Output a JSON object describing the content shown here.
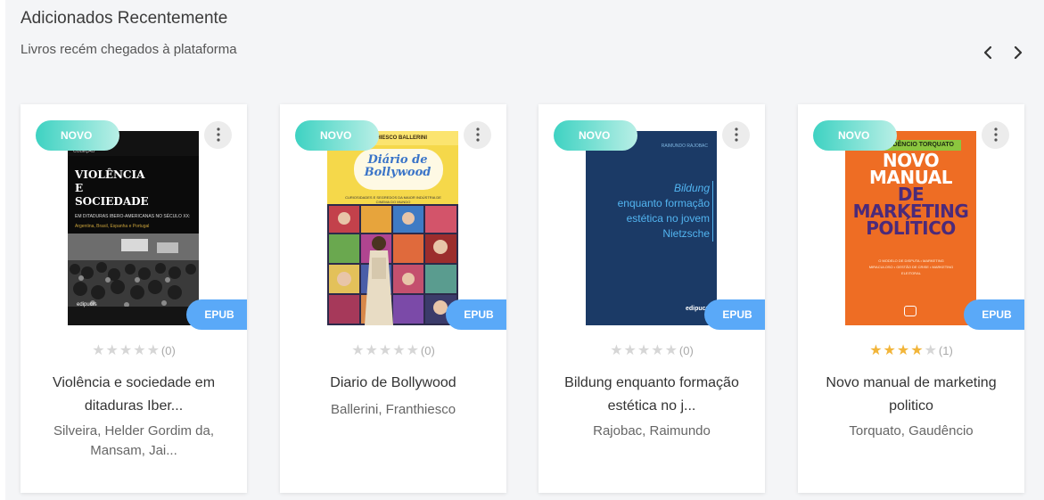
{
  "section": {
    "title": "Adicionados Recentemente",
    "subtitle": "Livros recém chegados à plataforma"
  },
  "nav": {
    "prev_icon": "chevron-left-icon",
    "next_icon": "chevron-right-icon"
  },
  "colors": {
    "novo_badge": "#3ed2c2",
    "epub_badge": "#5aa9f8",
    "star_on": "#f2b53a",
    "star_off": "#d6d6d6"
  },
  "books": [
    {
      "badge": "NOVO",
      "format": "EPUB",
      "rating": 0,
      "rating_count": "(0)",
      "title": "Violência e sociedade em ditaduras Iber...",
      "author": "Silveira, Helder Gordim da, Mansam, Jai...",
      "cover": {
        "series": "COLEÇÃO",
        "title_l1": "VIOLÊNCIA",
        "title_l2": "E",
        "title_l3": "SOCIEDADE",
        "subtitle": "EM DITADURAS IBERO-AMERICANAS NO SÉCULO XX:",
        "subtitle2": "Argentina, Brasil, Espanha e Portugal",
        "publisher": "edipucrs"
      }
    },
    {
      "badge": "NOVO",
      "format": "EPUB",
      "rating": 0,
      "rating_count": "(0)",
      "title": "Diario de Bollywood",
      "author": "Ballerini, Franthiesco",
      "cover": {
        "author": "FRANTHIESCO BALLERINI",
        "title_l1": "Diário de",
        "title_l2": "Bollywood",
        "tagline": "CURIOSIDADES E SEGREDOS DA MAIOR INDÚSTRIA DE CINEMA DO MUNDO"
      }
    },
    {
      "badge": "NOVO",
      "format": "EPUB",
      "rating": 0,
      "rating_count": "(0)",
      "title": "Bildung enquanto formação estética no j...",
      "author": "Rajobac, Raimundo",
      "cover": {
        "author": "RAIMUNDO RAJOBAC",
        "line1": "Bildung",
        "line2": "enquanto formação",
        "line3": "estética no jovem",
        "line4": "Nietzsche",
        "publisher": "edipucrs"
      }
    },
    {
      "badge": "NOVO",
      "format": "EPUB",
      "rating": 4,
      "rating_count": "(1)",
      "title": "Novo manual de marketing politico",
      "author": "Torquato, Gaudêncio",
      "cover": {
        "author": "GAUDÊNCIO TORQUATO",
        "title_l1": "NOVO",
        "title_l2": "MANUAL",
        "title_l3": "DE",
        "title_l4": "MARKETING",
        "title_l5": "POLÍTICO",
        "bullets": "O MODELO DE DISPUTA • MARKETING MIRACULOSO • GESTÃO DE CRISE • MARKETING ELEITORAL"
      }
    }
  ]
}
